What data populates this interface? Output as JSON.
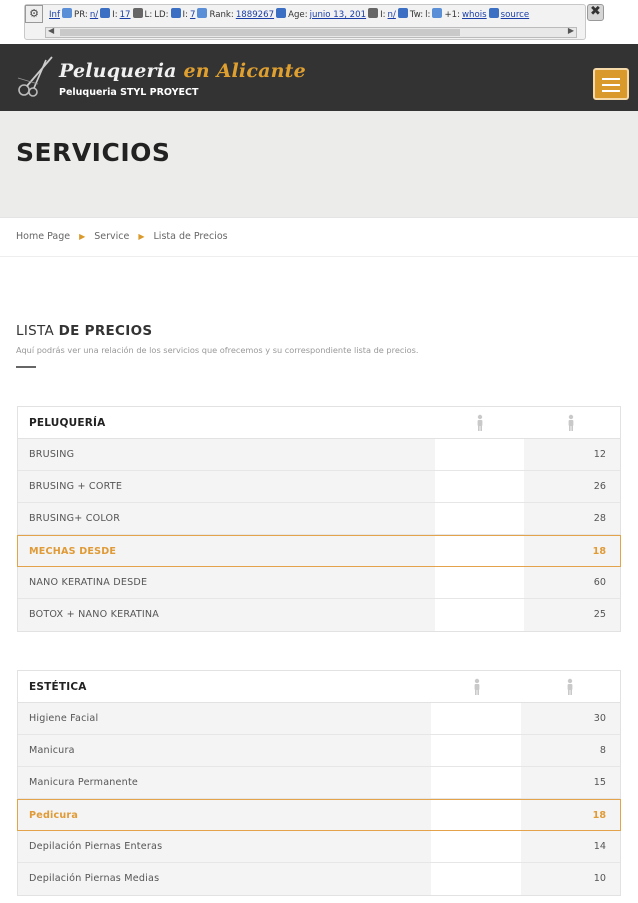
{
  "toolbar": {
    "items": [
      {
        "label": "Inf",
        "link": true
      },
      {
        "label": "PR:",
        "link": false
      },
      {
        "label": "n/",
        "link": true
      },
      {
        "label": "I:",
        "link": false
      },
      {
        "label": "17",
        "link": true
      },
      {
        "label": "L:",
        "link": false
      },
      {
        "label": "LD:",
        "link": false
      },
      {
        "label": "I:",
        "link": false
      },
      {
        "label": "7",
        "link": true
      },
      {
        "label": "Rank:",
        "link": false
      },
      {
        "label": "1889267",
        "link": true
      },
      {
        "label": "Age:",
        "link": false
      },
      {
        "label": "junio 13, 201",
        "link": true
      },
      {
        "label": "I:",
        "link": false
      },
      {
        "label": "n/",
        "link": true
      },
      {
        "label": "Tw:",
        "link": false
      },
      {
        "label": "l:",
        "link": false
      },
      {
        "label": "+1:",
        "link": false
      },
      {
        "label": "whois",
        "link": true
      },
      {
        "label": "source",
        "link": true
      }
    ],
    "close_label": "✖",
    "gear_label": "⚙"
  },
  "header": {
    "brand_main": "Peluqueria",
    "brand_accent": "en Alicante",
    "tagline": "Peluqueria STYL PROYECT",
    "accent_color": "#d99a2b"
  },
  "page": {
    "title": "SERVICIOS",
    "breadcrumb": [
      "Home Page",
      "Service",
      "Lista de Precios"
    ]
  },
  "section": {
    "heading_normal": "LISTA ",
    "heading_bold": "DE PRECIOS",
    "subtitle": "Aquí podrás ver una relación de los servicios que ofrecemos y su correspondiente lista de precios."
  },
  "tables": [
    {
      "category": "PELUQUERÍA",
      "column_icons": [
        "male-icon",
        "female-icon"
      ],
      "rows": [
        {
          "name": "BRUSING",
          "price": "12",
          "highlight": false
        },
        {
          "name": "BRUSING + CORTE",
          "price": "26",
          "highlight": false
        },
        {
          "name": "BRUSING+ COLOR",
          "price": "28",
          "highlight": false
        },
        {
          "name": "MECHAS DESDE",
          "price": "18",
          "highlight": true
        },
        {
          "name": "NANO KERATINA DESDE",
          "price": "60",
          "highlight": false
        },
        {
          "name": " BOTOX + NANO KERATINA",
          "price": "25",
          "highlight": false
        }
      ]
    },
    {
      "category": "ESTÉTICA",
      "column_icons": [
        "male-icon",
        "female-icon"
      ],
      "rows": [
        {
          "name": "Higiene Facial",
          "price": "30",
          "highlight": false
        },
        {
          "name": "Manicura",
          "price": "8",
          "highlight": false
        },
        {
          "name": "Manicura Permanente",
          "price": "15",
          "highlight": false
        },
        {
          "name": "Pedicura",
          "price": "18",
          "highlight": true
        },
        {
          "name": "Depilación Piernas Enteras",
          "price": "14",
          "highlight": false
        },
        {
          "name": "Depilación Piernas Medias",
          "price": "10",
          "highlight": false
        }
      ]
    }
  ]
}
